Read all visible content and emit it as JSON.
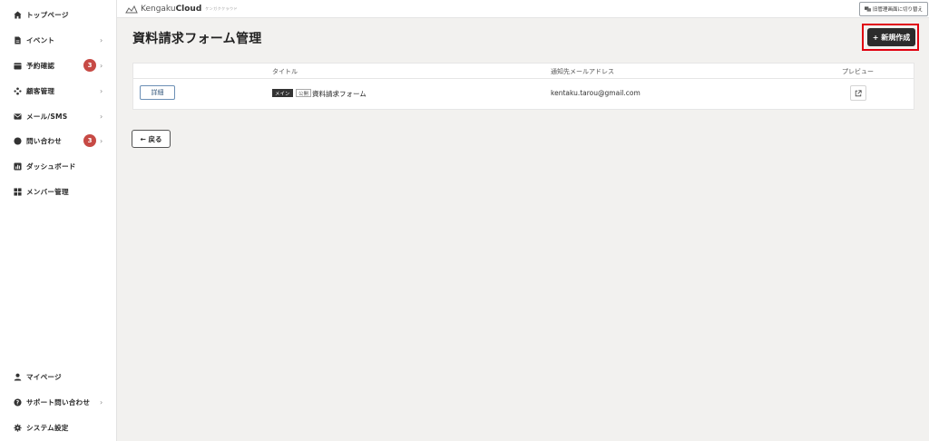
{
  "sidebar": {
    "items": [
      {
        "label": "トップページ",
        "icon": "home-icon"
      },
      {
        "label": "イベント",
        "icon": "document-icon",
        "chevron": "›"
      },
      {
        "label": "予約確認",
        "icon": "calendar-icon",
        "badge": "3",
        "chevron": "›"
      },
      {
        "label": "顧客管理",
        "icon": "users-icon",
        "chevron": "›"
      },
      {
        "label": "メール/SMS",
        "icon": "mail-icon",
        "chevron": "›"
      },
      {
        "label": "問い合わせ",
        "icon": "chat-icon",
        "badge": "3",
        "chevron": "›"
      },
      {
        "label": "ダッシュボード",
        "icon": "chart-icon"
      },
      {
        "label": "メンバー管理",
        "icon": "grid-icon"
      }
    ],
    "bottom_items": [
      {
        "label": "マイページ",
        "icon": "person-icon"
      },
      {
        "label": "サポート問い合わせ",
        "icon": "help-icon",
        "chevron": "›"
      },
      {
        "label": "システム設定",
        "icon": "gear-icon"
      }
    ]
  },
  "topbar": {
    "logo_light": "Kengaku",
    "logo_bold": "Cloud",
    "logo_sub": "ケンガククラウド",
    "switch_label": "旧管理画面に切り替え"
  },
  "page": {
    "title": "資料請求フォーム管理",
    "new_button": "+ 新規作成",
    "back_button": "← 戻る"
  },
  "table": {
    "headers": {
      "title": "タイトル",
      "email": "通知先メールアドレス",
      "preview": "プレビュー"
    },
    "rows": [
      {
        "detail_label": "詳細",
        "tag_main": "メイン",
        "tag_public": "公開",
        "title": "資料請求フォーム",
        "email": "kentaku.tarou@gmail.com"
      }
    ]
  },
  "colors": {
    "accent_dark": "#2c2c2c",
    "badge": "#c74a45",
    "highlight": "#e0000f",
    "background": "#f2f1ef"
  }
}
